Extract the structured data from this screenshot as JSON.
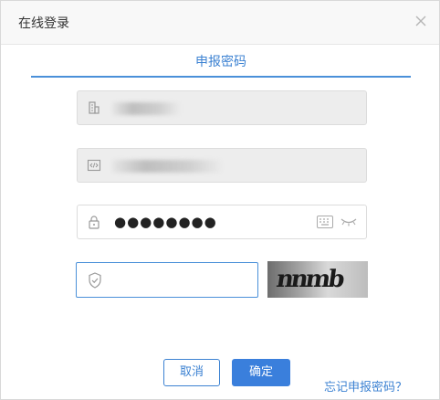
{
  "dialog": {
    "title": "在线登录",
    "close_icon": "close-icon"
  },
  "tabs": [
    {
      "label": "申报密码",
      "active": true
    }
  ],
  "fields": {
    "tax_id": {
      "icon": "building-icon",
      "value": "",
      "disabled": true
    },
    "code": {
      "icon": "code-icon",
      "value": "",
      "disabled": true
    },
    "password": {
      "icon": "lock-icon",
      "masked_value": "●●●●●●●●",
      "keyboard_icon": "keyboard-icon",
      "toggle_icon": "eye-closed-icon"
    },
    "captcha": {
      "icon": "shield-check-icon",
      "value": "",
      "image_text": "nnmb"
    }
  },
  "buttons": {
    "cancel_label": "取消",
    "confirm_label": "确定"
  },
  "links": {
    "forgot_password": "忘记申报密码？"
  },
  "colors": {
    "accent": "#3a7fdc",
    "disabled_bg": "#ededed"
  }
}
